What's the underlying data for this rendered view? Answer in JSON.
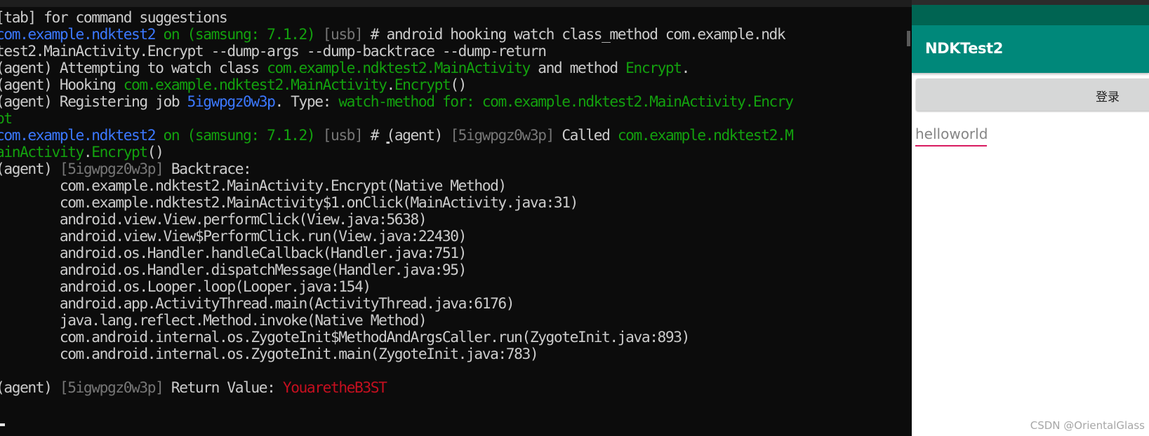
{
  "terminal": {
    "lines": [
      [
        {
          "t": "[tab] for command suggestions",
          "c": "w"
        }
      ],
      [
        {
          "t": "com.example.ndktest2",
          "c": "b"
        },
        {
          "t": " on (samsung: 7.1.2) ",
          "c": "g"
        },
        {
          "t": "[usb]",
          "c": "gr"
        },
        {
          "t": " # android hooking watch class_method com.example.ndk",
          "c": "w"
        }
      ],
      [
        {
          "t": "test2.MainActivity.Encrypt --dump-args --dump-backtrace --dump-return",
          "c": "w"
        }
      ],
      [
        {
          "t": "(agent) Attempting to watch class ",
          "c": "w"
        },
        {
          "t": "com.example.ndktest2.MainActivity",
          "c": "g"
        },
        {
          "t": " and method ",
          "c": "w"
        },
        {
          "t": "Encrypt",
          "c": "g"
        },
        {
          "t": ".",
          "c": "w"
        }
      ],
      [
        {
          "t": "(agent) Hooking ",
          "c": "w"
        },
        {
          "t": "com.example.ndktest2.MainActivity",
          "c": "g"
        },
        {
          "t": ".",
          "c": "w"
        },
        {
          "t": "Encrypt",
          "c": "g"
        },
        {
          "t": "()",
          "c": "w"
        }
      ],
      [
        {
          "t": "(agent) Registering job ",
          "c": "w"
        },
        {
          "t": "5igwpgz0w3p",
          "c": "b"
        },
        {
          "t": ". Type: ",
          "c": "w"
        },
        {
          "t": "watch-method for: com.example.ndktest2.MainActivity.Encry",
          "c": "g"
        }
      ],
      [
        {
          "t": "pt",
          "c": "g"
        }
      ],
      [
        {
          "t": "com.example.ndktest2",
          "c": "b"
        },
        {
          "t": " on (samsung: 7.1.2) ",
          "c": "g"
        },
        {
          "t": "[usb]",
          "c": "gr"
        },
        {
          "t": " # ",
          "c": "w"
        },
        {
          "t": "(",
          "c": "w",
          "u": true
        },
        {
          "t": "agent) ",
          "c": "w"
        },
        {
          "t": "[5igwpgz0w3p]",
          "c": "gr"
        },
        {
          "t": " Called ",
          "c": "w"
        },
        {
          "t": "com.example.ndktest2.M",
          "c": "g"
        }
      ],
      [
        {
          "t": "ainActivity",
          "c": "g"
        },
        {
          "t": ".",
          "c": "w"
        },
        {
          "t": "Encrypt",
          "c": "g"
        },
        {
          "t": "()",
          "c": "w"
        }
      ],
      [
        {
          "t": "(agent) ",
          "c": "w"
        },
        {
          "t": "[5igwpgz0w3p]",
          "c": "gr"
        },
        {
          "t": " Backtrace:",
          "c": "w"
        }
      ],
      [
        {
          "t": "        com.example.ndktest2.MainActivity.Encrypt(Native Method)",
          "c": "w"
        }
      ],
      [
        {
          "t": "        com.example.ndktest2.MainActivity$1.onClick(MainActivity.java:31)",
          "c": "w"
        }
      ],
      [
        {
          "t": "        android.view.View.performClick(View.java:5638)",
          "c": "w"
        }
      ],
      [
        {
          "t": "        android.view.View$PerformClick.run(View.java:22430)",
          "c": "w"
        }
      ],
      [
        {
          "t": "        android.os.Handler.handleCallback(Handler.java:751)",
          "c": "w"
        }
      ],
      [
        {
          "t": "        android.os.Handler.dispatchMessage(Handler.java:95)",
          "c": "w"
        }
      ],
      [
        {
          "t": "        android.os.Looper.loop(Looper.java:154)",
          "c": "w"
        }
      ],
      [
        {
          "t": "        android.app.ActivityThread.main(ActivityThread.java:6176)",
          "c": "w"
        }
      ],
      [
        {
          "t": "        java.lang.reflect.Method.invoke(Native Method)",
          "c": "w"
        }
      ],
      [
        {
          "t": "        com.android.internal.os.ZygoteInit$MethodAndArgsCaller.run(ZygoteInit.java:893)",
          "c": "w"
        }
      ],
      [
        {
          "t": "        com.android.internal.os.ZygoteInit.main(ZygoteInit.java:783)",
          "c": "w"
        }
      ],
      [],
      [
        {
          "t": "(agent) ",
          "c": "w"
        },
        {
          "t": "[5igwpgz0w3p]",
          "c": "gr"
        },
        {
          "t": " Return Value: ",
          "c": "w"
        },
        {
          "t": "YouaretheB3ST",
          "c": "r"
        }
      ]
    ]
  },
  "app": {
    "title": "NDKTest2",
    "login_button_label": "登录",
    "input_value": "helloworld"
  },
  "watermark": "CSDN @OrientalGlass",
  "colors": {
    "terminal_bg": "#0c0c0c",
    "terminal_text": "#cccccc",
    "blue": "#3b78ff",
    "green": "#13a10e",
    "gray": "#767676",
    "red": "#c50f1f",
    "status_bar": "#006452",
    "app_bar": "#00887a",
    "input_accent": "#d81b60"
  }
}
